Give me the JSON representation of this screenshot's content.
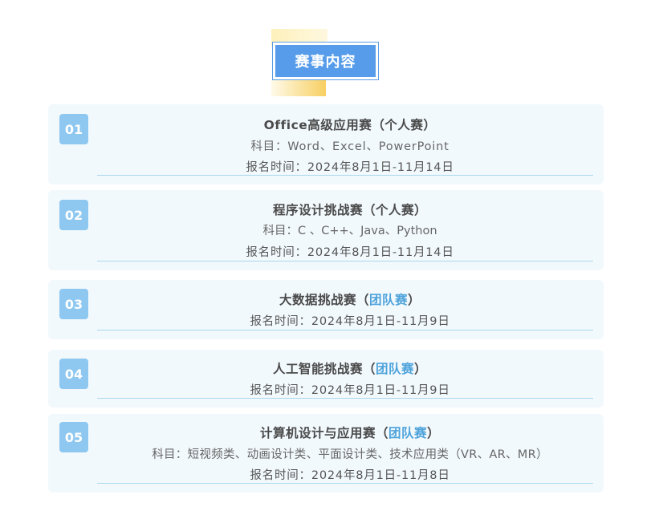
{
  "header": {
    "title": "赛事内容"
  },
  "cards": [
    {
      "number": "01",
      "name": "Office高级应用赛",
      "type_open": "（",
      "type": "个人赛",
      "type_close": "）",
      "subjects": "科目：Word、Excel、PowerPoint",
      "registration": "报名时间：2024年8月1日-11月14日"
    },
    {
      "number": "02",
      "name": "程序设计挑战赛",
      "type_open": "（",
      "type": "个人赛",
      "type_close": "）",
      "subjects": "科目：C 、C++、Java、Python",
      "registration": "报名时间：2024年8月1日-11月14日"
    },
    {
      "number": "03",
      "name": "大数据挑战赛",
      "type_open": "（",
      "type": "团队赛",
      "type_close": "）",
      "registration": "报名时间：2024年8月1日-11月9日"
    },
    {
      "number": "04",
      "name": "人工智能挑战赛",
      "type_open": "（",
      "type": "团队赛",
      "type_close": "）",
      "registration": "报名时间：2024年8月1日-11月9日"
    },
    {
      "number": "05",
      "name": "计算机设计与应用赛",
      "type_open": "（",
      "type": "团队赛",
      "type_close": "）",
      "subjects": "科目：短视频类、动画设计类、平面设计类、技术应用类（VR、AR、MR）",
      "registration": "报名时间：2024年8月1日-11月8日"
    }
  ],
  "colors": {
    "title_bg": "#569cea",
    "number_bg": "#8ec8f0",
    "card_bg": "#f2f9fd",
    "team_text": "#4ea3db",
    "rule": "#a9d7ef"
  }
}
